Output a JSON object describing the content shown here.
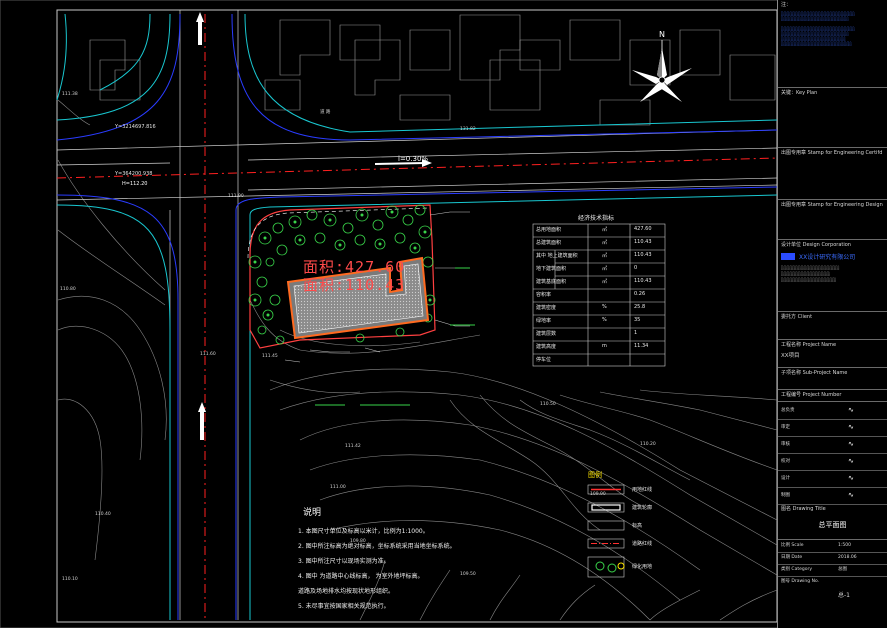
{
  "site": {
    "area_label": "面积:427.60",
    "area2_label": "面积:110.43",
    "road_label": "i=0.30%",
    "elev_label": "H=112.20",
    "north_label": "N"
  },
  "title_block": {
    "top_text": "注：",
    "key_plan": "关键：Key Plan",
    "stamp1": "出图专用章 Stamp for Engineering Certifd",
    "stamp2": "出图专用章 Stamp for Engineering Design",
    "design_corp": "设计单位 Design Corporation",
    "company_cn": "XX设计研究有限公司",
    "client": "委托方 Client",
    "project_name_label": "工程名称 Project Name",
    "project_name_value": "XX项目",
    "subproject_label": "子项名称 Sub-Project Name",
    "project_number_label": "工程编号 Project Number",
    "drawing_title_label": "图名 Drawing Title",
    "drawing_title_value": "总平面图",
    "scale_label": "比例 Scale",
    "scale_value": "1:500",
    "date_label": "日期 Date",
    "date_value": "2018.06",
    "category_label": "类别 Category",
    "category_value": "总图",
    "drawing_no_label": "图号 Drawing No.",
    "drawing_no_value": "总-1",
    "sign_rows": [
      "总负责",
      "审定",
      "审核",
      "校对",
      "设计",
      "制图"
    ]
  },
  "table": {
    "title": "经济技术指标",
    "rows": [
      {
        "name": "总用地面积",
        "unit": "㎡",
        "value": "427.60"
      },
      {
        "name": "总建筑面积",
        "unit": "㎡",
        "value": "110.43"
      },
      {
        "name": "其中 地上建筑面积",
        "unit": "㎡",
        "value": "110.43"
      },
      {
        "name": "地下建筑面积",
        "unit": "㎡",
        "value": "0"
      },
      {
        "name": "建筑基底面积",
        "unit": "㎡",
        "value": "110.43"
      },
      {
        "name": "容积率",
        "unit": "",
        "value": "0.26"
      },
      {
        "name": "建筑密度",
        "unit": "%",
        "value": "25.8"
      },
      {
        "name": "绿地率",
        "unit": "%",
        "value": "35"
      },
      {
        "name": "建筑层数",
        "unit": "",
        "value": "1"
      },
      {
        "name": "建筑高度",
        "unit": "m",
        "value": "11.34"
      },
      {
        "name": "停车位",
        "unit": "",
        "value": ""
      }
    ]
  },
  "legend": {
    "title": "图例",
    "items": [
      "用地红线",
      "建筑轮廓",
      "标高",
      "道路红线",
      "绿化用地"
    ]
  },
  "notes": {
    "title": "说明",
    "lines": [
      "1. 本图尺寸单位及标高以米计，比例为1:1000。",
      "2. 图中所注标高为绝对标高，坐标系统采用当地坐标系统。",
      "3. 图中所注尺寸以现场实测为准。",
      "4. 图中    为道路中心线标高，    为室外地坪标高。",
      "   道路及场地排水均按现状地形组织。",
      "5. 未尽事宜按国家相关规范执行。"
    ]
  }
}
